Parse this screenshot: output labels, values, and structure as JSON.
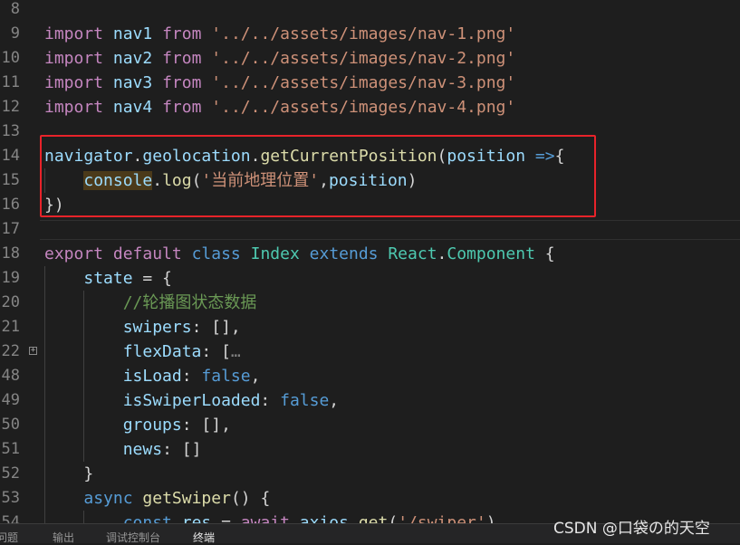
{
  "editor": {
    "lines": [
      {
        "num": "8",
        "tokens": []
      },
      {
        "num": "9",
        "tokens": [
          {
            "t": "import",
            "c": "ctl"
          },
          {
            "t": " "
          },
          {
            "t": "nav1",
            "c": "var"
          },
          {
            "t": " "
          },
          {
            "t": "from",
            "c": "ctl"
          },
          {
            "t": " "
          },
          {
            "t": "'../../assets/images/nav-1.png'",
            "c": "str"
          }
        ]
      },
      {
        "num": "10",
        "tokens": [
          {
            "t": "import",
            "c": "ctl"
          },
          {
            "t": " "
          },
          {
            "t": "nav2",
            "c": "var"
          },
          {
            "t": " "
          },
          {
            "t": "from",
            "c": "ctl"
          },
          {
            "t": " "
          },
          {
            "t": "'../../assets/images/nav-2.png'",
            "c": "str"
          }
        ]
      },
      {
        "num": "11",
        "tokens": [
          {
            "t": "import",
            "c": "ctl"
          },
          {
            "t": " "
          },
          {
            "t": "nav3",
            "c": "var"
          },
          {
            "t": " "
          },
          {
            "t": "from",
            "c": "ctl"
          },
          {
            "t": " "
          },
          {
            "t": "'../../assets/images/nav-3.png'",
            "c": "str"
          }
        ]
      },
      {
        "num": "12",
        "tokens": [
          {
            "t": "import",
            "c": "ctl"
          },
          {
            "t": " "
          },
          {
            "t": "nav4",
            "c": "var"
          },
          {
            "t": " "
          },
          {
            "t": "from",
            "c": "ctl"
          },
          {
            "t": " "
          },
          {
            "t": "'../../assets/images/nav-4.png'",
            "c": "str"
          }
        ]
      },
      {
        "num": "13",
        "tokens": []
      },
      {
        "num": "14",
        "tokens": [
          {
            "t": "navigator",
            "c": "var"
          },
          {
            "t": "."
          },
          {
            "t": "geolocation",
            "c": "var"
          },
          {
            "t": "."
          },
          {
            "t": "getCurrentPosition",
            "c": "fn"
          },
          {
            "t": "("
          },
          {
            "t": "position",
            "c": "var"
          },
          {
            "t": " "
          },
          {
            "t": "=>",
            "c": "kw"
          },
          {
            "t": "{"
          }
        ]
      },
      {
        "num": "15",
        "indent": 1,
        "tokens": [
          {
            "t": "    "
          },
          {
            "t": "console",
            "c": "var hl"
          },
          {
            "t": "."
          },
          {
            "t": "log",
            "c": "fn"
          },
          {
            "t": "("
          },
          {
            "t": "'当前地理位置'",
            "c": "str"
          },
          {
            "t": ","
          },
          {
            "t": "position",
            "c": "var"
          },
          {
            "t": ")"
          }
        ]
      },
      {
        "num": "16",
        "tokens": [
          {
            "t": "})"
          }
        ]
      },
      {
        "num": "17",
        "tokens": []
      },
      {
        "num": "18",
        "tokens": [
          {
            "t": "export",
            "c": "ctl"
          },
          {
            "t": " "
          },
          {
            "t": "default",
            "c": "ctl"
          },
          {
            "t": " "
          },
          {
            "t": "class",
            "c": "kw"
          },
          {
            "t": " "
          },
          {
            "t": "Index",
            "c": "cls"
          },
          {
            "t": " "
          },
          {
            "t": "extends",
            "c": "kw"
          },
          {
            "t": " "
          },
          {
            "t": "React",
            "c": "cls"
          },
          {
            "t": "."
          },
          {
            "t": "Component",
            "c": "cls"
          },
          {
            "t": " {"
          }
        ]
      },
      {
        "num": "19",
        "indent": 1,
        "tokens": [
          {
            "t": "    "
          },
          {
            "t": "state",
            "c": "var"
          },
          {
            "t": " = {"
          }
        ]
      },
      {
        "num": "20",
        "indent": 2,
        "tokens": [
          {
            "t": "        "
          },
          {
            "t": "//轮播图状态数据",
            "c": "cmt"
          }
        ]
      },
      {
        "num": "21",
        "indent": 2,
        "tokens": [
          {
            "t": "        "
          },
          {
            "t": "swipers",
            "c": "var"
          },
          {
            "t": ": [],"
          }
        ]
      },
      {
        "num": "22",
        "indent": 2,
        "fold": true,
        "tokens": [
          {
            "t": "        "
          },
          {
            "t": "flexData",
            "c": "var"
          },
          {
            "t": ": ["
          },
          {
            "t": "…",
            "c": "dim"
          }
        ]
      },
      {
        "num": "48",
        "indent": 2,
        "tokens": [
          {
            "t": "        "
          },
          {
            "t": "isLoad",
            "c": "var"
          },
          {
            "t": ": "
          },
          {
            "t": "false",
            "c": "kw"
          },
          {
            "t": ","
          }
        ]
      },
      {
        "num": "49",
        "indent": 2,
        "tokens": [
          {
            "t": "        "
          },
          {
            "t": "isSwiperLoaded",
            "c": "var"
          },
          {
            "t": ": "
          },
          {
            "t": "false",
            "c": "kw"
          },
          {
            "t": ","
          }
        ]
      },
      {
        "num": "50",
        "indent": 2,
        "tokens": [
          {
            "t": "        "
          },
          {
            "t": "groups",
            "c": "var"
          },
          {
            "t": ": [],"
          }
        ]
      },
      {
        "num": "51",
        "indent": 2,
        "tokens": [
          {
            "t": "        "
          },
          {
            "t": "news",
            "c": "var"
          },
          {
            "t": ": []"
          }
        ]
      },
      {
        "num": "52",
        "indent": 1,
        "tokens": [
          {
            "t": "    "
          },
          {
            "t": "}"
          }
        ]
      },
      {
        "num": "53",
        "indent": 1,
        "tokens": [
          {
            "t": "    "
          },
          {
            "t": "async",
            "c": "kw"
          },
          {
            "t": " "
          },
          {
            "t": "getSwiper",
            "c": "fn"
          },
          {
            "t": "() {"
          }
        ]
      },
      {
        "num": "54",
        "indent": 2,
        "tokens": [
          {
            "t": "        "
          },
          {
            "t": "const",
            "c": "kw"
          },
          {
            "t": " "
          },
          {
            "t": "res",
            "c": "var"
          },
          {
            "t": " = "
          },
          {
            "t": "await",
            "c": "ctl"
          },
          {
            "t": " "
          },
          {
            "t": "axios",
            "c": "var"
          },
          {
            "t": "."
          },
          {
            "t": "get",
            "c": "fn"
          },
          {
            "t": "("
          },
          {
            "t": "'/swiper'",
            "c": "str"
          },
          {
            "t": ")"
          }
        ]
      }
    ]
  },
  "panel": {
    "tabs": [
      {
        "label": "问题",
        "active": false
      },
      {
        "label": "输出",
        "active": false
      },
      {
        "label": "调试控制台",
        "active": false
      },
      {
        "label": "终端",
        "active": true
      }
    ]
  },
  "watermark": "CSDN @口袋の的天空"
}
